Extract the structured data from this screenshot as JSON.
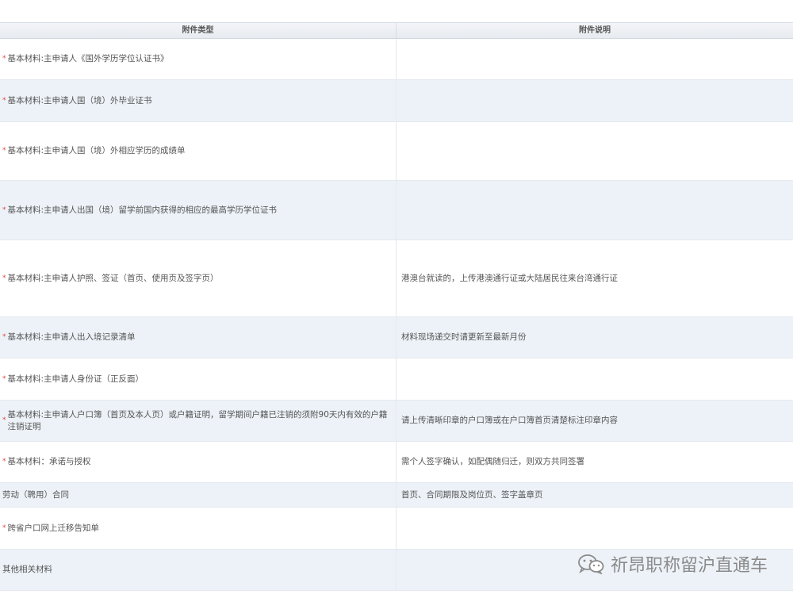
{
  "header": {
    "col1": "附件类型",
    "col2": "附件说明"
  },
  "rows": [
    {
      "required": true,
      "type": "基本材料:主申请人《国外学历学位认证书》",
      "note": ""
    },
    {
      "required": true,
      "type": "基本材料:主申请人国（境）外毕业证书",
      "note": ""
    },
    {
      "required": true,
      "type": "基本材料:主申请人国（境）外相应学历的成绩单",
      "note": ""
    },
    {
      "required": true,
      "type": "基本材料:主申请人出国（境）留学前国内获得的相应的最高学历学位证书",
      "note": ""
    },
    {
      "required": true,
      "type": "基本材料:主申请人护照、签证（首页、使用页及签字页）",
      "note": "港澳台就读的，上传港澳通行证或大陆居民往来台湾通行证"
    },
    {
      "required": true,
      "type": "基本材料:主申请人出入境记录清单",
      "note": "材料现场递交时请更新至最新月份"
    },
    {
      "required": true,
      "type": "基本材料:主申请人身份证（正反面）",
      "note": ""
    },
    {
      "required": true,
      "type": "基本材料:主申请人户口簿（首页及本人页）或户籍证明，留学期间户籍已注销的须附90天内有效的户籍注销证明",
      "note": "请上传清晰印章的户口簿或在户口簿首页清楚标注印章内容"
    },
    {
      "required": true,
      "type": "基本材料：承诺与授权",
      "note": "需个人签字确认，如配偶随归迁，则双方共同签署"
    },
    {
      "required": false,
      "type": "劳动（聘用）合同",
      "note": "首页、合同期限及岗位页、签字盖章页"
    },
    {
      "required": true,
      "type": "跨省户口网上迁移告知单",
      "note": ""
    },
    {
      "required": false,
      "type": "其他相关材料",
      "note": ""
    }
  ],
  "required_mark": "*",
  "watermark": {
    "text": "祈昂职称留沪直通车",
    "icon": "wechat-icon"
  }
}
